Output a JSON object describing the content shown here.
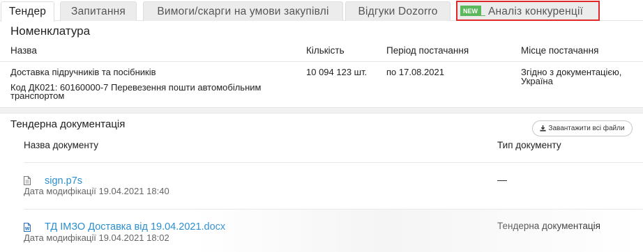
{
  "tabs": [
    {
      "label": "Тендер"
    },
    {
      "label": "Запитання"
    },
    {
      "label": "Вимоги/скарги на умови закупівлі"
    },
    {
      "label": "Відгуки Dozorro"
    },
    {
      "label": "Аналіз конкуренції",
      "badge": "NEW"
    }
  ],
  "nomenclature": {
    "title": "Номенклатура",
    "headers": {
      "name": "Назва",
      "qty": "Кількість",
      "period": "Період постачання",
      "place": "Місце постачання"
    },
    "row": {
      "name": "Доставка підручників та посібників",
      "qty": "10 094 123 шт.",
      "period": "по 17.08.2021",
      "place_line1": "Згідно з документацією,",
      "place_line2": "Україна",
      "code_line1": "Код ДК021: 60160000-7 Перевезення пошти автомобільним",
      "code_line2": "транспортом"
    }
  },
  "docs": {
    "title": "Тендерна документація",
    "download_all": "Завантажити всі файли",
    "headers": {
      "name": "Назва документу",
      "type": "Тип документу"
    },
    "items": [
      {
        "name": "sign.p7s",
        "modified": "Дата модифікації 19.04.2021 18:40",
        "type": "—",
        "icon": "file-icon"
      },
      {
        "name": "ТД ІМЗО Доставка від 19.04.2021.docx",
        "modified": "Дата модифікації 19.04.2021 18:02",
        "type": "Тендерна документація",
        "icon": "word-file-icon"
      }
    ]
  }
}
